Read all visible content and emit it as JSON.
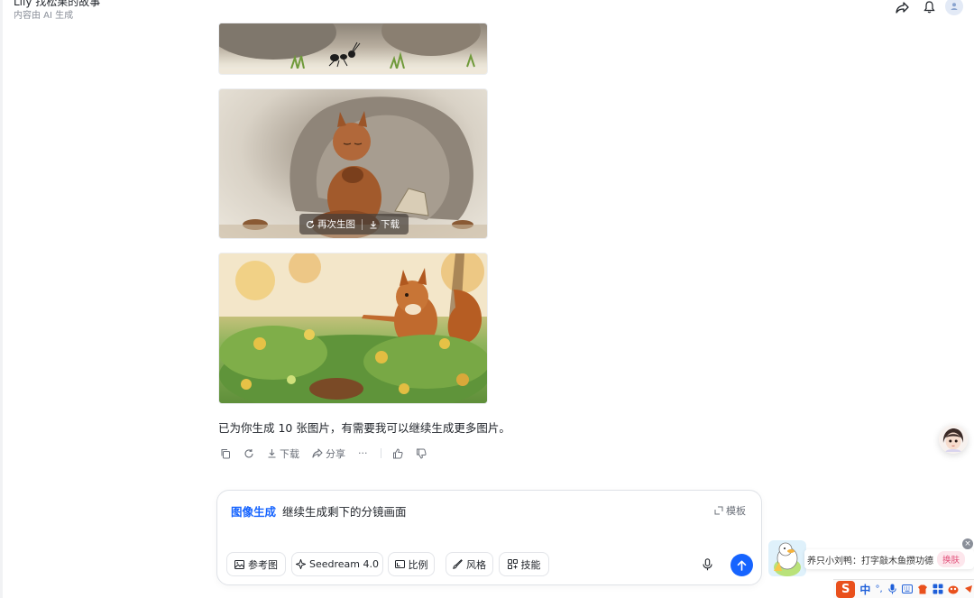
{
  "header": {
    "title": "Lily 找松果的故事",
    "subtitle": "内容由 AI 生成"
  },
  "image_overlay": {
    "regenerate_label": "再次生图",
    "download_label": "下载"
  },
  "message": {
    "text": "已为你生成 10 张图片，有需要我可以继续生成更多图片。"
  },
  "actions": {
    "download_label": "下载",
    "share_label": "分享",
    "more_label": "···"
  },
  "input": {
    "mode_label": "图像生成",
    "prompt_value": "继续生成剩下的分镜画面",
    "template_label": "模板",
    "tools": {
      "reference_label": "参考图",
      "model_label": "Seedream 4.0",
      "ratio_label": "比例",
      "style_label": "风格",
      "skill_label": "技能"
    }
  },
  "ime": {
    "popup_text": "养只小刘鸭：打字敲木鱼攒功德",
    "skin_label": "换肤",
    "close_label": "×",
    "logo": "S",
    "lang_label": "中",
    "punct_label": "°,"
  },
  "colors": {
    "accent": "#1664ff",
    "text": "#1f2329",
    "muted": "#6b7079"
  }
}
